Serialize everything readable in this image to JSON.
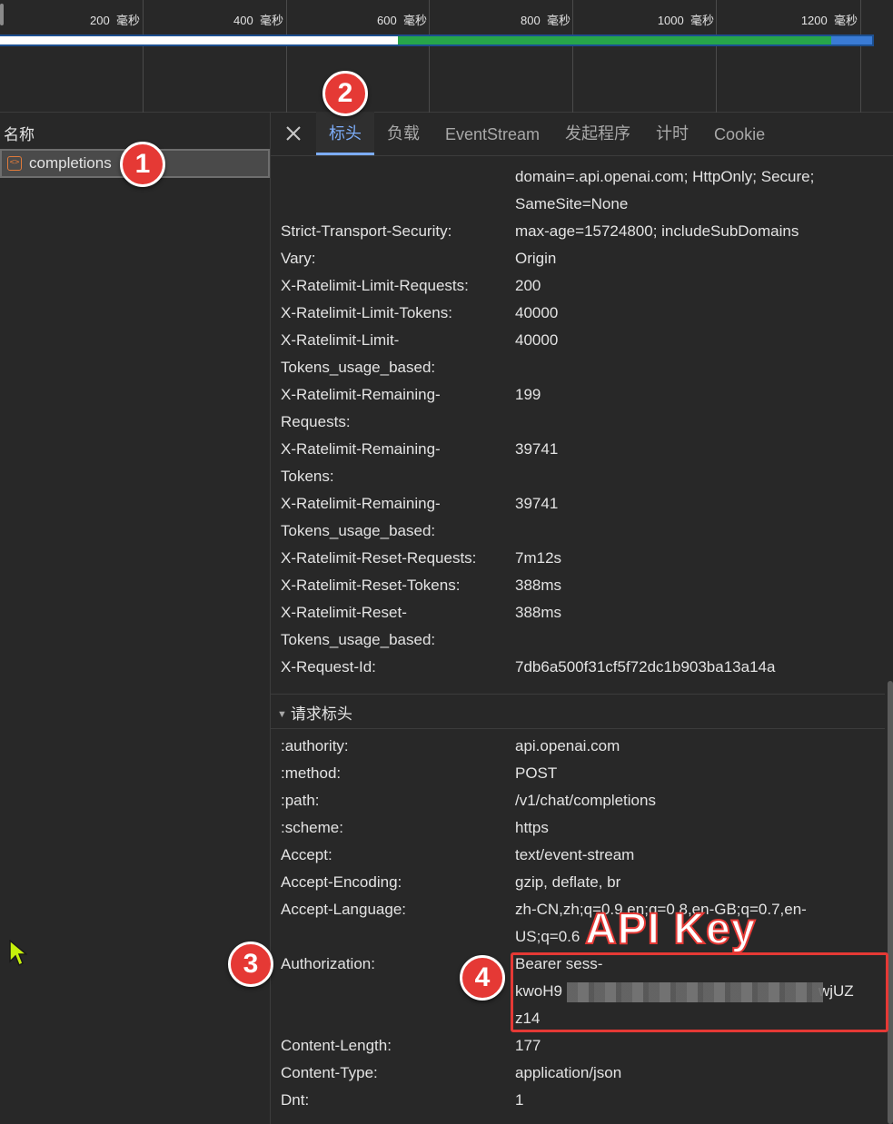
{
  "timeline": {
    "ticks": [
      {
        "value": "200",
        "unit": "毫秒"
      },
      {
        "value": "400",
        "unit": "毫秒"
      },
      {
        "value": "600",
        "unit": "毫秒"
      },
      {
        "value": "800",
        "unit": "毫秒"
      },
      {
        "value": "1000",
        "unit": "毫秒"
      },
      {
        "value": "1200",
        "unit": "毫秒"
      }
    ]
  },
  "left_panel": {
    "header": "名称",
    "request_name": "completions"
  },
  "tabs": [
    {
      "label": "标头",
      "active": true
    },
    {
      "label": "负载",
      "active": false
    },
    {
      "label": "EventStream",
      "active": false
    },
    {
      "label": "发起程序",
      "active": false
    },
    {
      "label": "计时",
      "active": false
    },
    {
      "label": "Cookie",
      "active": false
    }
  ],
  "response_headers_tail": {
    "cookie_cont_1": "domain=.api.openai.com; HttpOnly; Secure;",
    "cookie_cont_2": "SameSite=None",
    "rows": [
      {
        "name": "Strict-Transport-Security:",
        "value": "max-age=15724800; includeSubDomains"
      },
      {
        "name": "Vary:",
        "value": "Origin"
      },
      {
        "name": "X-Ratelimit-Limit-Requests:",
        "value": "200"
      },
      {
        "name": "X-Ratelimit-Limit-Tokens:",
        "value": "40000"
      },
      {
        "name": "X-Ratelimit-Limit-",
        "name2": "Tokens_usage_based:",
        "value": "40000"
      },
      {
        "name": "X-Ratelimit-Remaining-",
        "name2": "Requests:",
        "value": "199"
      },
      {
        "name": "X-Ratelimit-Remaining-",
        "name2": "Tokens:",
        "value": "39741"
      },
      {
        "name": "X-Ratelimit-Remaining-",
        "name2": "Tokens_usage_based:",
        "value": "39741"
      },
      {
        "name": "X-Ratelimit-Reset-Requests:",
        "value": "7m12s"
      },
      {
        "name": "X-Ratelimit-Reset-Tokens:",
        "value": "388ms"
      },
      {
        "name": "X-Ratelimit-Reset-",
        "name2": "Tokens_usage_based:",
        "value": "388ms"
      },
      {
        "name": "X-Request-Id:",
        "value": "7db6a500f31cf5f72dc1b903ba13a14a"
      }
    ]
  },
  "request_headers": {
    "title": "请求标头",
    "rows": [
      {
        "name": ":authority:",
        "value": "api.openai.com"
      },
      {
        "name": ":method:",
        "value": "POST"
      },
      {
        "name": ":path:",
        "value": "/v1/chat/completions"
      },
      {
        "name": ":scheme:",
        "value": "https"
      },
      {
        "name": "Accept:",
        "value": "text/event-stream"
      },
      {
        "name": "Accept-Encoding:",
        "value": "gzip, deflate, br"
      },
      {
        "name": "Accept-Language:",
        "value": "zh-CN,zh;q=0.9,en;q=0.8,en-GB;q=0.7,en-",
        "value2": "US;q=0.6"
      },
      {
        "name": "Authorization:",
        "value": "Bearer sess-",
        "value2_prefix": "kwoH9",
        "value2_suffix": "wjUZ",
        "value3": "z14"
      },
      {
        "name": "Content-Length:",
        "value": "177"
      },
      {
        "name": "Content-Type:",
        "value": "application/json"
      },
      {
        "name": "Dnt:",
        "value": "1"
      }
    ]
  },
  "annotations": {
    "badge1": "1",
    "badge2": "2",
    "badge3": "3",
    "badge4": "4",
    "api_key_label": "API Key",
    "accent_color": "#e53935"
  }
}
